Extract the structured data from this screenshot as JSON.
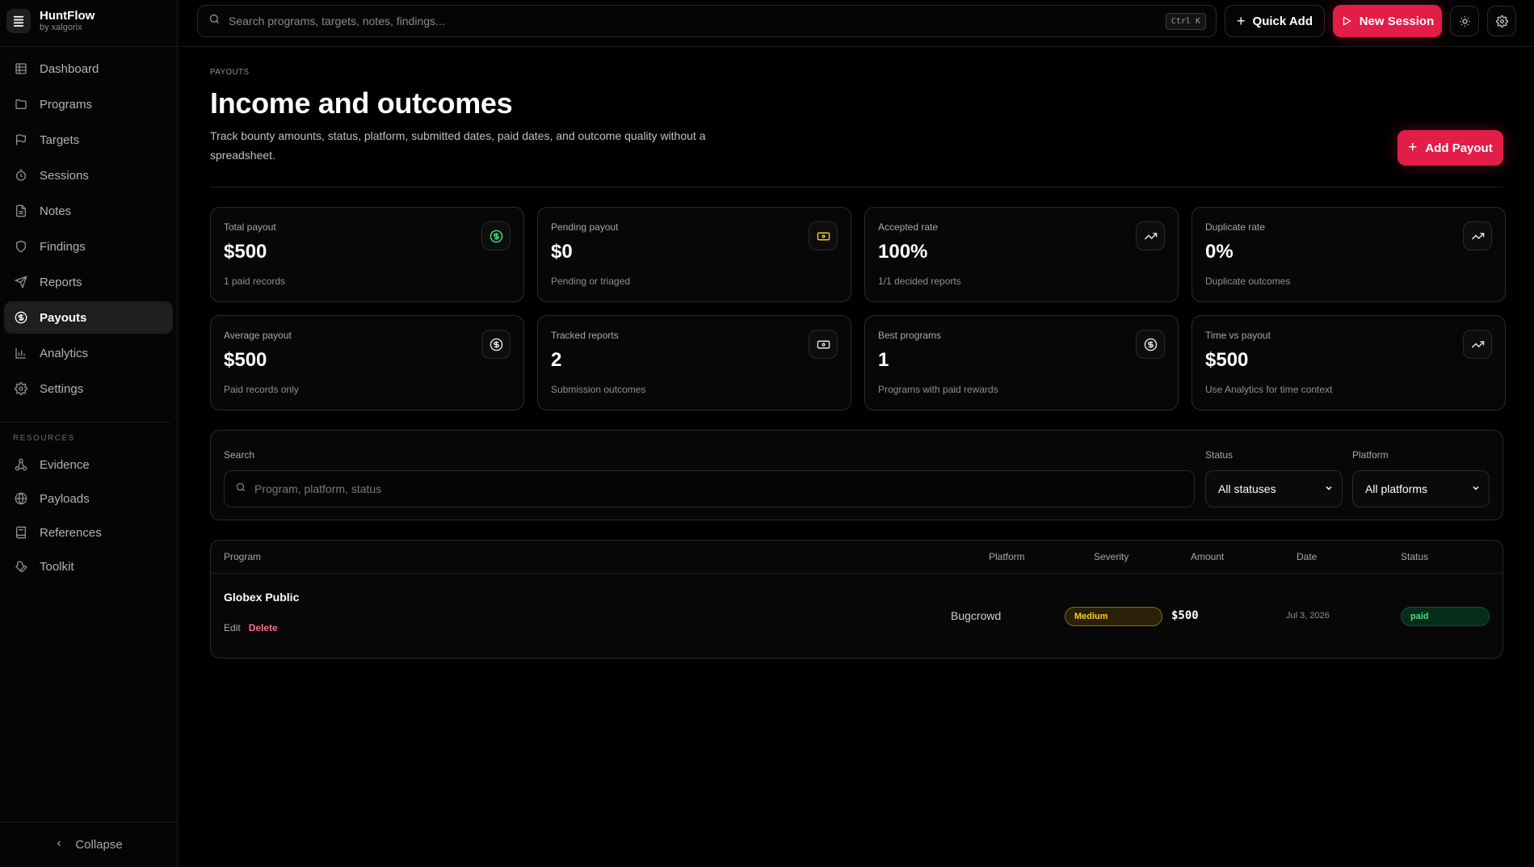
{
  "brand": {
    "name": "HuntFlow",
    "sub": "by xalgorix"
  },
  "sidebar": {
    "items": [
      {
        "label": "Dashboard",
        "icon": "table-icon",
        "active": false
      },
      {
        "label": "Programs",
        "icon": "folder-icon",
        "active": false
      },
      {
        "label": "Targets",
        "icon": "flag-icon",
        "active": false
      },
      {
        "label": "Sessions",
        "icon": "timer-icon",
        "active": false
      },
      {
        "label": "Notes",
        "icon": "file-text-icon",
        "active": false
      },
      {
        "label": "Findings",
        "icon": "shield-icon",
        "active": false
      },
      {
        "label": "Reports",
        "icon": "send-icon",
        "active": false
      },
      {
        "label": "Payouts",
        "icon": "dollar-circle-icon",
        "active": true
      },
      {
        "label": "Analytics",
        "icon": "bar-chart-icon",
        "active": false
      },
      {
        "label": "Settings",
        "icon": "gear-icon",
        "active": false
      }
    ],
    "resources_label": "RESOURCES",
    "resources": [
      {
        "label": "Evidence",
        "icon": "nodes-icon"
      },
      {
        "label": "Payloads",
        "icon": "globe-icon"
      },
      {
        "label": "References",
        "icon": "book-icon"
      },
      {
        "label": "Toolkit",
        "icon": "wrench-icon"
      }
    ],
    "collapse_label": "Collapse"
  },
  "topbar": {
    "search_placeholder": "Search programs, targets, notes, findings...",
    "shortcut": "Ctrl K",
    "quick_add": "Quick Add",
    "new_session": "New Session"
  },
  "page": {
    "breadcrumb": "PAYOUTS",
    "title": "Income and outcomes",
    "description": "Track bounty amounts, status, platform, submitted dates, paid dates, and outcome quality without a spreadsheet.",
    "add_button": "Add Payout"
  },
  "stats": [
    {
      "label": "Total payout",
      "value": "$500",
      "sub": "1 paid records",
      "icon": "dollar-circle-icon",
      "icon_color": "#4ade80"
    },
    {
      "label": "Pending payout",
      "value": "$0",
      "sub": "Pending or triaged",
      "icon": "banknote-icon",
      "icon_color": "#facc15"
    },
    {
      "label": "Accepted rate",
      "value": "100%",
      "sub": "1/1 decided reports",
      "icon": "trending-up-icon",
      "icon_color": "#e6e6e6"
    },
    {
      "label": "Duplicate rate",
      "value": "0%",
      "sub": "Duplicate outcomes",
      "icon": "trending-up-icon",
      "icon_color": "#e6e6e6"
    },
    {
      "label": "Average payout",
      "value": "$500",
      "sub": "Paid records only",
      "icon": "dollar-circle-icon",
      "icon_color": "#e6e6e6"
    },
    {
      "label": "Tracked reports",
      "value": "2",
      "sub": "Submission outcomes",
      "icon": "banknote-icon",
      "icon_color": "#e6e6e6"
    },
    {
      "label": "Best programs",
      "value": "1",
      "sub": "Programs with paid rewards",
      "icon": "dollar-circle-icon",
      "icon_color": "#e6e6e6"
    },
    {
      "label": "Time vs payout",
      "value": "$500",
      "sub": "Use Analytics for time context",
      "icon": "trending-up-icon",
      "icon_color": "#e6e6e6"
    }
  ],
  "filters": {
    "search_label": "Search",
    "search_placeholder": "Program, platform, status",
    "status_label": "Status",
    "status_value": "All statuses",
    "platform_label": "Platform",
    "platform_value": "All platforms"
  },
  "table": {
    "columns": [
      "Program",
      "Platform",
      "Severity",
      "Amount",
      "Date",
      "Status"
    ],
    "rows": [
      {
        "program": "Globex Public",
        "edit": "Edit",
        "delete": "Delete",
        "platform": "Bugcrowd",
        "severity": "Medium",
        "amount": "$500",
        "date": "Jul 3, 2026",
        "status": "paid"
      }
    ]
  }
}
